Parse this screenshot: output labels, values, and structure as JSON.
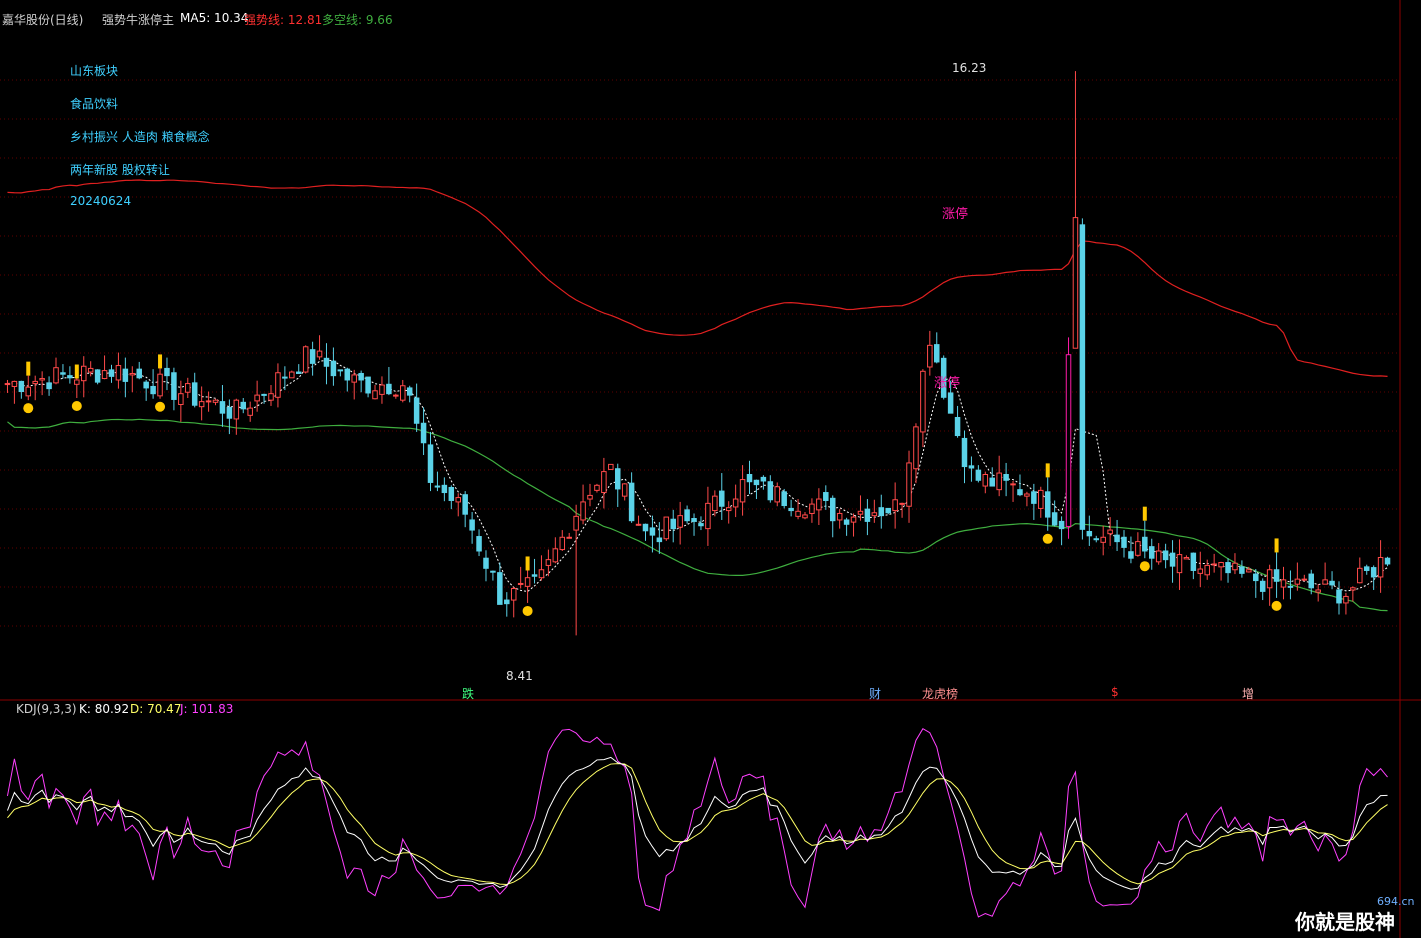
{
  "header": {
    "stock_name": "嘉华股份(日线)",
    "indicator_name": "强势牛涨停主",
    "ma5_label": "MA5: 10.34",
    "strong_label": "强势线: 12.81",
    "longshort_label": "多空线: 9.66"
  },
  "info_lines": [
    "山东板块",
    "食品饮料",
    "乡村振兴 人造肉 粮食概念",
    "两年新股 股权转让",
    "20240624"
  ],
  "kdj_header": {
    "name": "KDJ(9,3,3)",
    "k": "K: 80.92",
    "d": "D: 70.47",
    "j": "J: 101.83"
  },
  "event_markers": [
    "跌",
    "财",
    "龙虎榜",
    "$",
    "增"
  ],
  "limit_up_labels": [
    "涨停",
    "涨停"
  ],
  "watermark": {
    "text": "你就是股神",
    "site": "694.cn"
  },
  "colors": {
    "up": "#ff4a4a",
    "down": "#5bd2e8",
    "limit_up": "#ff1aa8",
    "signal_yellow": "#ffc800",
    "strong_line": "#e02020",
    "longshort_line": "#3fae3f",
    "k_line": "#ffffff",
    "d_line": "#ffff66",
    "j_line": "#ff40ff",
    "info_text": "#3fd0ff"
  },
  "chart_data": {
    "type": "candlestick",
    "y_unit": "price",
    "ylim": [
      8.0,
      16.8
    ],
    "highest": {
      "index": 154,
      "value": 16.23,
      "label": "16.23"
    },
    "lowest": {
      "index": 82,
      "value": 8.41,
      "label": "8.41"
    },
    "series_strong_line": "strong",
    "series_longshort_line": "longshort",
    "candles": [],
    "kdj": {
      "K": [],
      "D": [],
      "J": []
    }
  }
}
